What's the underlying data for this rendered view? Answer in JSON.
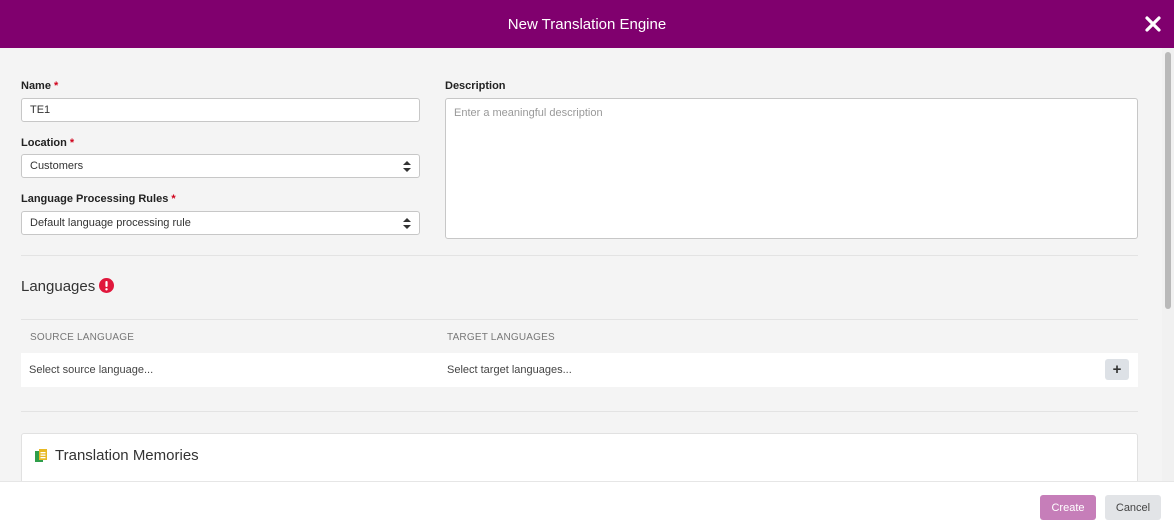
{
  "dialog": {
    "title": "New Translation Engine",
    "close_icon": "close-x-icon"
  },
  "form": {
    "name": {
      "label": "Name",
      "required_mark": "*",
      "value": "TE1"
    },
    "location": {
      "label": "Location",
      "required_mark": "*",
      "value": "Customers"
    },
    "lpr": {
      "label": "Language Processing Rules",
      "required_mark": "*",
      "value": "Default language processing rule"
    },
    "description": {
      "label": "Description",
      "placeholder": "Enter a meaningful description"
    }
  },
  "languages": {
    "title": "Languages",
    "alert_icon": "exclamation-circle-icon",
    "source_header": "SOURCE LANGUAGE",
    "target_header": "TARGET LANGUAGES",
    "source_placeholder": "Select source language...",
    "target_placeholder": "Select target languages...",
    "add_label": "+"
  },
  "translation_memories": {
    "title": "Translation Memories",
    "icon": "translation-memory-icon"
  },
  "footer": {
    "create_label": "Create",
    "cancel_label": "Cancel"
  },
  "colors": {
    "header_bg": "#80006e",
    "create_bg": "#c67eb9",
    "required": "#d0021b",
    "alert": "#e0173c"
  }
}
